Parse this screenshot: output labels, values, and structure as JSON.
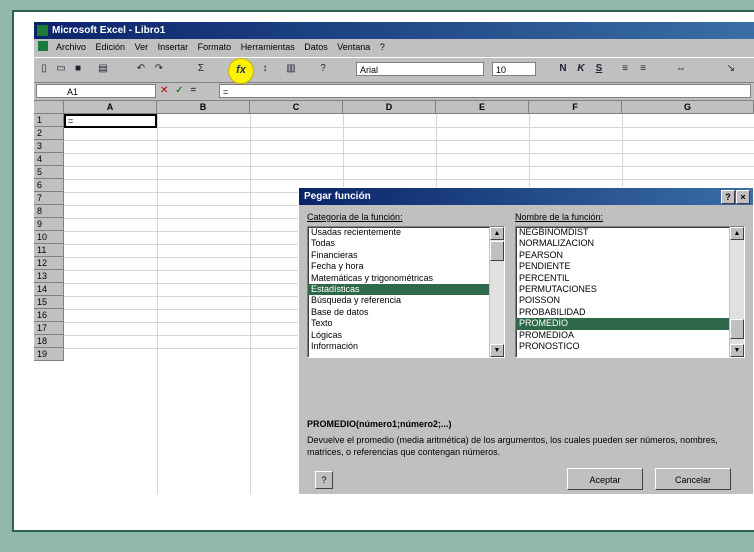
{
  "window": {
    "title": "Microsoft Excel - Libro1"
  },
  "menu": [
    "Archivo",
    "Edición",
    "Ver",
    "Insertar",
    "Formato",
    "Herramientas",
    "Datos",
    "Ventana",
    "?"
  ],
  "toolbar": {
    "font": "Arial",
    "size": "10",
    "fx_label": "fx",
    "bold": "N",
    "italic": "K",
    "underline": "S"
  },
  "formula_bar": {
    "name_box": "A1",
    "cancel": "✕",
    "enter": "✓",
    "equals": "=",
    "value": "="
  },
  "grid": {
    "columns": [
      "A",
      "B",
      "C",
      "D",
      "E",
      "F",
      "G"
    ],
    "rows": [
      "1",
      "2",
      "3",
      "4",
      "5",
      "6",
      "7",
      "8",
      "9",
      "10",
      "11",
      "12",
      "13",
      "14",
      "15",
      "16",
      "17",
      "18",
      "19"
    ],
    "a1_value": "="
  },
  "dialog": {
    "title": "Pegar función",
    "help_btn": "?",
    "close_btn": "×",
    "category_label": "Categoría de la función:",
    "categories": [
      "Usadas recientemente",
      "Todas",
      "Financieras",
      "Fecha y hora",
      "Matemáticas y trigonométricas",
      "Estadísticas",
      "Búsqueda y referencia",
      "Base de datos",
      "Texto",
      "Lógicas",
      "Información"
    ],
    "selected_category": 5,
    "function_label": "Nombre de la función:",
    "functions": [
      "NEGBINOMDIST",
      "NORMALIZACION",
      "PEARSON",
      "PENDIENTE",
      "PERCENTIL",
      "PERMUTACIONES",
      "POISSON",
      "PROBABILIDAD",
      "PROMEDIO",
      "PROMEDIOA",
      "PRONOSTICO"
    ],
    "selected_function": 8,
    "syntax": "PROMEDIO(número1;número2;...)",
    "description": "Devuelve el promedio (media aritmética) de los argumentos, los cuales pueden ser números, nombres, matrices, o referencias que contengan números.",
    "office_assistant": "?",
    "ok": "Aceptar",
    "cancel": "Cancelar"
  }
}
